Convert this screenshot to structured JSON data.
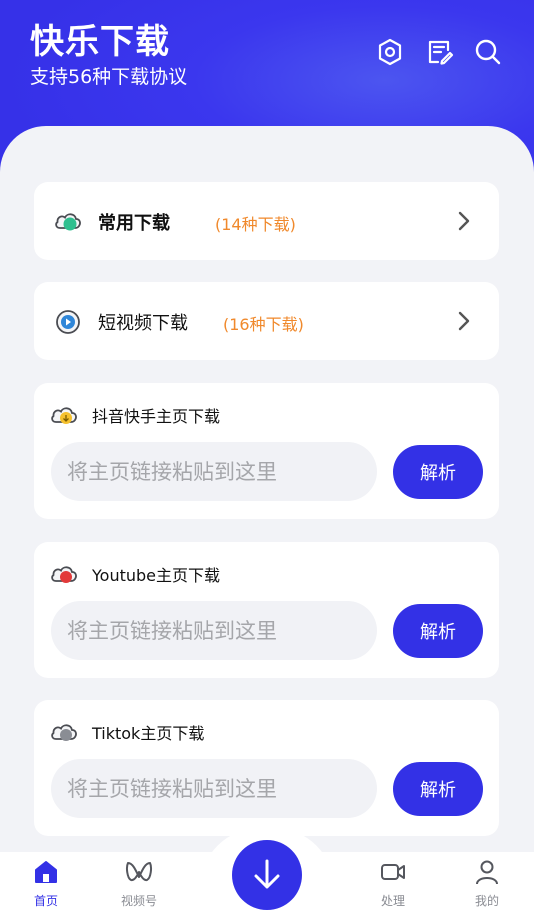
{
  "header": {
    "title": "快乐下载",
    "subtitle": "支持56种下载协议",
    "icons": [
      "settings-icon",
      "notes-icon",
      "search-icon"
    ]
  },
  "nav_cards": [
    {
      "title": "常用下载",
      "count": "(14种下载)",
      "icon": "cloud-icon"
    },
    {
      "title": "短视频下载",
      "count": "(16种下载)",
      "icon": "video-disc-icon"
    }
  ],
  "download_cards": [
    {
      "title": "抖音快手主页下载",
      "placeholder": "将主页链接粘贴到这里",
      "button": "解析",
      "icon": "cloud-yellow-icon"
    },
    {
      "title": "Youtube主页下载",
      "placeholder": "将主页链接粘贴到这里",
      "button": "解析",
      "icon": "cloud-red-icon"
    },
    {
      "title": "Tiktok主页下载",
      "placeholder": "将主页链接粘贴到这里",
      "button": "解析",
      "icon": "cloud-gray-icon"
    }
  ],
  "tabbar": {
    "home": "首页",
    "channels": "视频号",
    "process": "处理",
    "mine": "我的",
    "active": "home"
  },
  "colors": {
    "accent": "#3331e6",
    "orange": "#f0892c",
    "background": "#f2f3f7"
  }
}
